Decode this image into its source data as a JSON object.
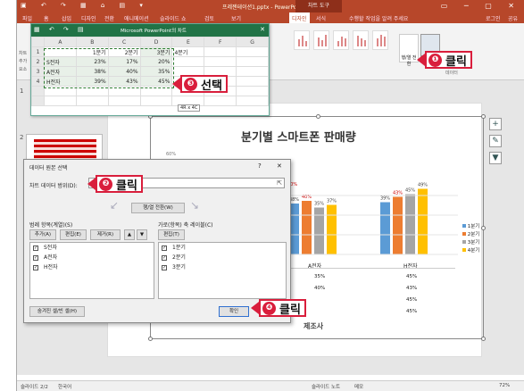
{
  "ppt": {
    "title": "프레젠테이션1.pptx - PowerPoint",
    "context_tab": "차트 도구",
    "tabs": [
      "파일",
      "홈",
      "삽입",
      "디자인",
      "전환",
      "애니메이션",
      "슬라이드 쇼",
      "검토",
      "보기",
      "디자인",
      "서식"
    ],
    "search_hint": "수행할 작업을 알려 주세요",
    "user": "로그인",
    "share": "공유",
    "ribbon_left": [
      "차트",
      "추가",
      "요소"
    ],
    "ribbon_btn_switch": "행/열 전환",
    "ribbon_btn_select": "데이터 선택",
    "ribbon_group": "데이터",
    "slide_numbers": [
      "1",
      "2"
    ],
    "status": {
      "slide": "슬라이드 2/2",
      "lang": "한국어",
      "notes": "슬라이드 노트",
      "memo": "메모",
      "zoom": "72%"
    }
  },
  "chart": {
    "title": "분기별 스마트폰 판매량",
    "axis_top_label": "60%",
    "legend": [
      "1분기",
      "2분기",
      "3분기",
      "4분기"
    ],
    "colors": [
      "#5b9bd5",
      "#ed7d31",
      "#a5a5a5",
      "#ffc000"
    ],
    "companies": [
      "S전자",
      "A전자",
      "H전자"
    ],
    "visible_labels": {
      "s_q2": "20%",
      "a": [
        "38%",
        "40%",
        "35%",
        "37%"
      ],
      "h": [
        "39%",
        "43%",
        "45%",
        "49%"
      ]
    },
    "table_rows": [
      "35%",
      "40%",
      "45%",
      "45%"
    ],
    "x_title": "제조사"
  },
  "chart_data": {
    "type": "bar",
    "title": "분기별 스마트폰 판매량",
    "categories": [
      "S전자",
      "A전자",
      "H전자"
    ],
    "series": [
      {
        "name": "1분기",
        "values": [
          23,
          38,
          39
        ]
      },
      {
        "name": "2분기",
        "values": [
          17,
          40,
          43
        ]
      },
      {
        "name": "3분기",
        "values": [
          20,
          35,
          45
        ]
      },
      {
        "name": "4분기",
        "values": [
          null,
          37,
          49
        ]
      }
    ],
    "xlabel": "제조사",
    "ylabel": "",
    "ylim": [
      0,
      60
    ],
    "legend_position": "right"
  },
  "excel": {
    "title": "Microsoft PowerPoint의 차트",
    "cols": [
      "",
      "A",
      "B",
      "C",
      "D",
      "E",
      "F",
      "G"
    ],
    "rows": [
      [
        "1",
        "",
        "1분기",
        "2분기",
        "3분기",
        "4분기",
        "",
        ""
      ],
      [
        "2",
        "S전자",
        "23%",
        "17%",
        "20%",
        "",
        "",
        ""
      ],
      [
        "3",
        "A전자",
        "38%",
        "40%",
        "35%",
        "",
        "",
        ""
      ],
      [
        "4",
        "H전자",
        "39%",
        "43%",
        "45%",
        "",
        "",
        ""
      ]
    ],
    "size_tip": "4R x 4C"
  },
  "dialog": {
    "title": "데이터 원본 선택",
    "help": "?",
    "close": "✕",
    "range_label": "차트 데이터 범위(D):",
    "switch_btn": "행/열 전환(W)",
    "legend_header": "범례 항목(계열)(S)",
    "axis_header": "가로(항목) 축 레이블(C)",
    "add": "추가(A)",
    "edit": "편집(E)",
    "remove": "제거(R)",
    "edit2": "편집(T)",
    "series_items": [
      "S전자",
      "A전자",
      "H전자"
    ],
    "axis_items": [
      "1분기",
      "2분기",
      "3분기"
    ],
    "hidden_btn": "숨겨진 셀/빈 셀(H)",
    "ok": "확인",
    "cancel": "취소"
  },
  "callouts": [
    {
      "num": "❶",
      "text": "클릭"
    },
    {
      "num": "❷",
      "text": "클릭"
    },
    {
      "num": "❸",
      "text": "선택"
    },
    {
      "num": "❹",
      "text": "클릭"
    }
  ]
}
